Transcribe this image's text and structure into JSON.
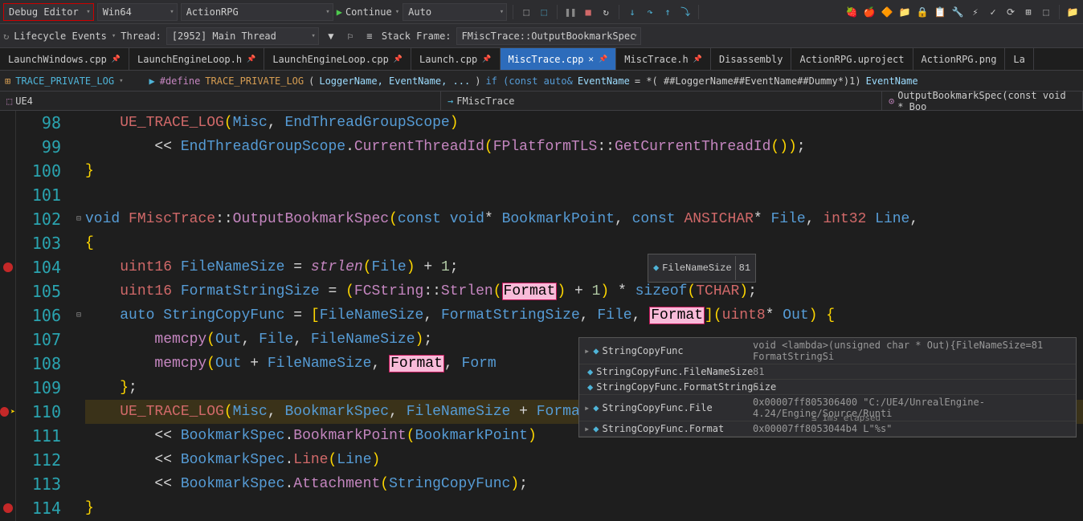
{
  "toolbar": {
    "config": "Debug Editor",
    "platform": "Win64",
    "project": "ActionRPG",
    "continue": "Continue",
    "auto": "Auto"
  },
  "debugbar": {
    "lifecycle": "Lifecycle Events",
    "thread_label": "Thread:",
    "thread_value": "[2952] Main Thread",
    "stackframe_label": "Stack Frame:",
    "stackframe_value": "FMiscTrace::OutputBookmarkSpec"
  },
  "tabs": [
    {
      "label": "LaunchWindows.cpp",
      "active": false,
      "pin": true
    },
    {
      "label": "LaunchEngineLoop.h",
      "active": false,
      "pin": true
    },
    {
      "label": "LaunchEngineLoop.cpp",
      "active": false,
      "pin": true
    },
    {
      "label": "Launch.cpp",
      "active": false,
      "pin": true
    },
    {
      "label": "MiscTrace.cpp",
      "active": true,
      "pin": true,
      "close": true
    },
    {
      "label": "MiscTrace.h",
      "active": false,
      "pin": true
    },
    {
      "label": "Disassembly",
      "active": false
    },
    {
      "label": "ActionRPG.uproject",
      "active": false
    },
    {
      "label": "ActionRPG.png",
      "active": false
    },
    {
      "label": "La",
      "active": false
    }
  ],
  "navbar": {
    "symbol": "TRACE_PRIVATE_LOG",
    "define_kw": "#define",
    "macro_name": "TRACE_PRIVATE_LOG",
    "params": "LoggerName, EventName, ...",
    "body_prefix": "if (const auto&",
    "body_var": "EventName",
    "body_suffix": "= *( ##LoggerName##EventName##Dummy*)1)",
    "body_end": "EventName"
  },
  "context": {
    "scope": "UE4",
    "class": "FMiscTrace",
    "method": "OutputBookmarkSpec(const void * Boo"
  },
  "tooltip": {
    "name": "FileNameSize",
    "value": "81"
  },
  "debug_panel": {
    "rows": [
      {
        "name": "StringCopyFunc",
        "value": "void <lambda>(unsigned char * Out){FileNameSize=81 FormatStringSi",
        "expand": true
      },
      {
        "name": "StringCopyFunc.FileNameSize",
        "value": "81"
      },
      {
        "name": "StringCopyFunc.FormatStringSize",
        "value": "6"
      },
      {
        "name": "StringCopyFunc.File",
        "value": "0x00007ff805306400 \"C:/UE4/UnrealEngine-4.24/Engine/Source/Runti",
        "expand": true
      },
      {
        "name": "StringCopyFunc.Format",
        "value": "0x00007ff8053044b4 L\"%s\"",
        "expand": true
      }
    ],
    "elapsed": "≤ 1ms elapsed"
  },
  "code": {
    "lines": [
      {
        "n": 98,
        "html": "    <span class='macro1'>UE_TRACE_LOG</span><span class='paren'>(</span><span class='ident'>Misc</span>, <span class='ident'>EndThreadGroupScope</span><span class='paren'>)</span>"
      },
      {
        "n": 99,
        "html": "        &lt;&lt; <span class='ident'>EndThreadGroupScope</span>.<span class='func'>CurrentThreadId</span><span class='paren'>(</span><span class='func'>FPlatformTLS</span>::<span class='func'>GetCurrentThreadId</span><span class='paren'>())</span>;"
      },
      {
        "n": 100,
        "html": "<span class='paren'>}</span>"
      },
      {
        "n": 101,
        "html": ""
      },
      {
        "n": 102,
        "html": "<span class='kw2'>void</span> <span class='type'>FMiscTrace</span>::<span class='func'>OutputBookmarkSpec</span><span class='paren'>(</span><span class='kw2'>const</span> <span class='kw2'>void</span>* <span class='ident'>BookmarkPoint</span>, <span class='kw2'>const</span> <span class='type'>ANSICHAR</span>* <span class='ident'>File</span>, <span class='type'>int32</span> <span class='ident'>Line</span>,",
        "fold": "⊟"
      },
      {
        "n": 103,
        "html": "<span class='paren'>{</span>"
      },
      {
        "n": 104,
        "html": "    <span class='type'>uint16</span> <span class='ident'>FileNameSize</span> = <span class='func italic'>strlen</span><span class='paren'>(</span><span class='ident'>File</span><span class='paren'>)</span> + <span class='num'>1</span>;",
        "bp": true
      },
      {
        "n": 105,
        "html": "    <span class='type'>uint16</span> <span class='ident'>FormatStringSize</span> = <span class='paren'>(</span><span class='func'>FCString</span>::<span class='func'>Strlen</span><span class='paren'>(</span><span class='hl-pink'>Format</span><span class='paren'>)</span> + <span class='num'>1</span><span class='paren'>)</span> * <span class='kw2'>sizeof</span><span class='paren'>(</span><span class='type'>TCHAR</span><span class='paren'>)</span>;"
      },
      {
        "n": 106,
        "html": "    <span class='kw2'>auto</span> <span class='ident'>StringCopyFunc</span> = <span class='paren'>[</span><span class='ident'>FileNameSize</span>, <span class='ident'>FormatStringSize</span>, <span class='ident'>File</span>, <span class='hl-pink'>Format</span><span class='paren'>]</span><span class='paren'>(</span><span class='type'>uint8</span>* <span class='ident'>Out</span><span class='paren'>)</span> <span class='paren'>{</span>",
        "fold": "⊟"
      },
      {
        "n": 107,
        "html": "        <span class='func'>memcpy</span><span class='paren'>(</span><span class='ident'>Out</span>, <span class='ident'>File</span>, <span class='ident'>FileNameSize</span><span class='paren'>)</span>;"
      },
      {
        "n": 108,
        "html": "        <span class='func'>memcpy</span><span class='paren'>(</span><span class='ident'>Out</span> + <span class='ident'>FileNameSize</span>, <span class='hl-pink'>Format</span>, <span class='ident'>Form</span>"
      },
      {
        "n": 109,
        "html": "    <span class='paren'>}</span>;"
      },
      {
        "n": 110,
        "html": "    <span class='macro1'>UE_TRACE_LOG</span><span class='paren'>(</span><span class='ident'>Misc</span>, <span class='ident'>BookmarkSpec</span>, <span class='ident'>FileNameSize</span> + <span class='ident'>FormatStringSize</span><span class='paren'>)</span>",
        "bp": true,
        "exec": true,
        "arrow": true
      },
      {
        "n": 111,
        "html": "        &lt;&lt; <span class='ident'>BookmarkSpec</span>.<span class='func'>BookmarkPoint</span><span class='paren'>(</span><span class='ident'>BookmarkPoint</span><span class='paren'>)</span>"
      },
      {
        "n": 112,
        "html": "        &lt;&lt; <span class='ident'>BookmarkSpec</span>.<span class='type'>Line</span><span class='paren'>(</span><span class='ident'>Line</span><span class='paren'>)</span>"
      },
      {
        "n": 113,
        "html": "        &lt;&lt; <span class='ident'>BookmarkSpec</span>.<span class='func'>Attachment</span><span class='paren'>(</span><span class='ident'>StringCopyFunc</span><span class='paren'>)</span>;"
      },
      {
        "n": 114,
        "html": "<span class='paren'>}</span>",
        "bp": true
      }
    ]
  }
}
